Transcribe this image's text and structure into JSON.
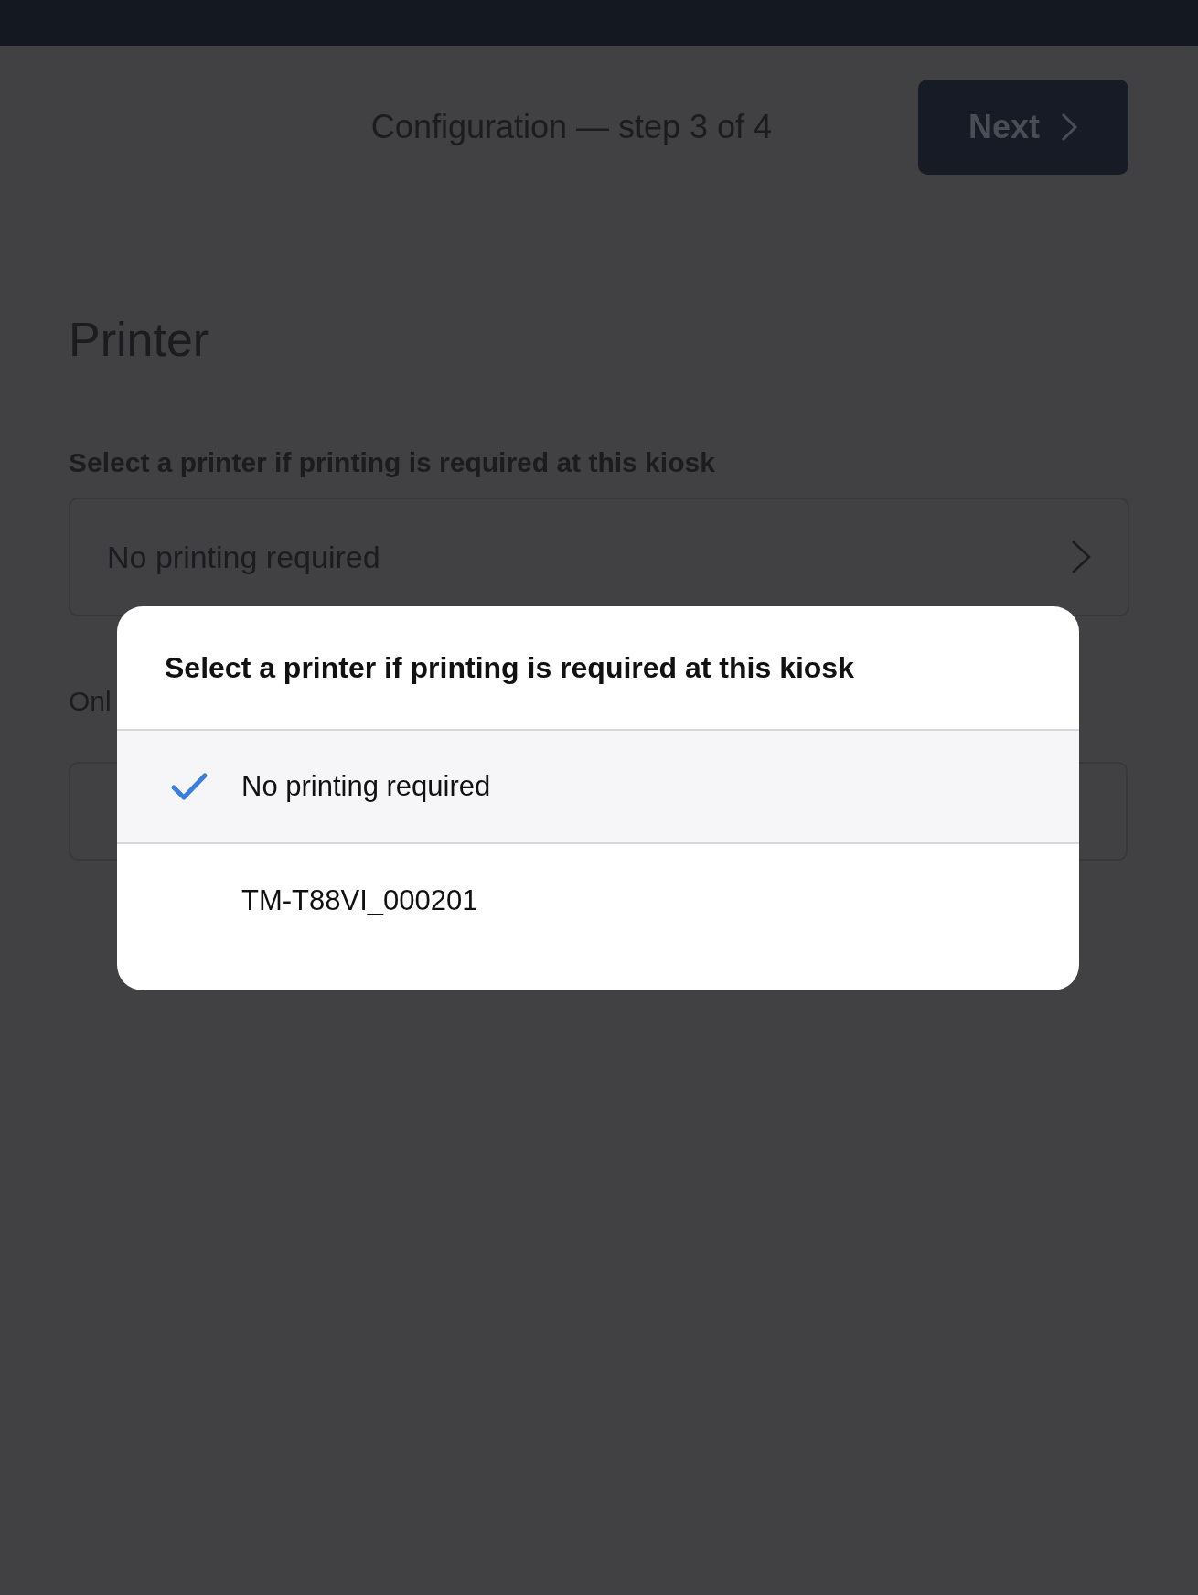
{
  "header": {
    "step_title": "Configuration — step 3 of 4",
    "next_button": "Next"
  },
  "page": {
    "title": "Printer",
    "printer_label": "Select a printer if printing is required at this kiosk",
    "printer_select": {
      "value": "No printing required"
    },
    "note_partial": "Onl"
  },
  "dialog": {
    "title": "Select a printer if printing is required at this kiosk",
    "options": [
      {
        "label": "No printing required",
        "selected": true
      },
      {
        "label": "TM-T88VI_000201",
        "selected": false
      }
    ]
  }
}
